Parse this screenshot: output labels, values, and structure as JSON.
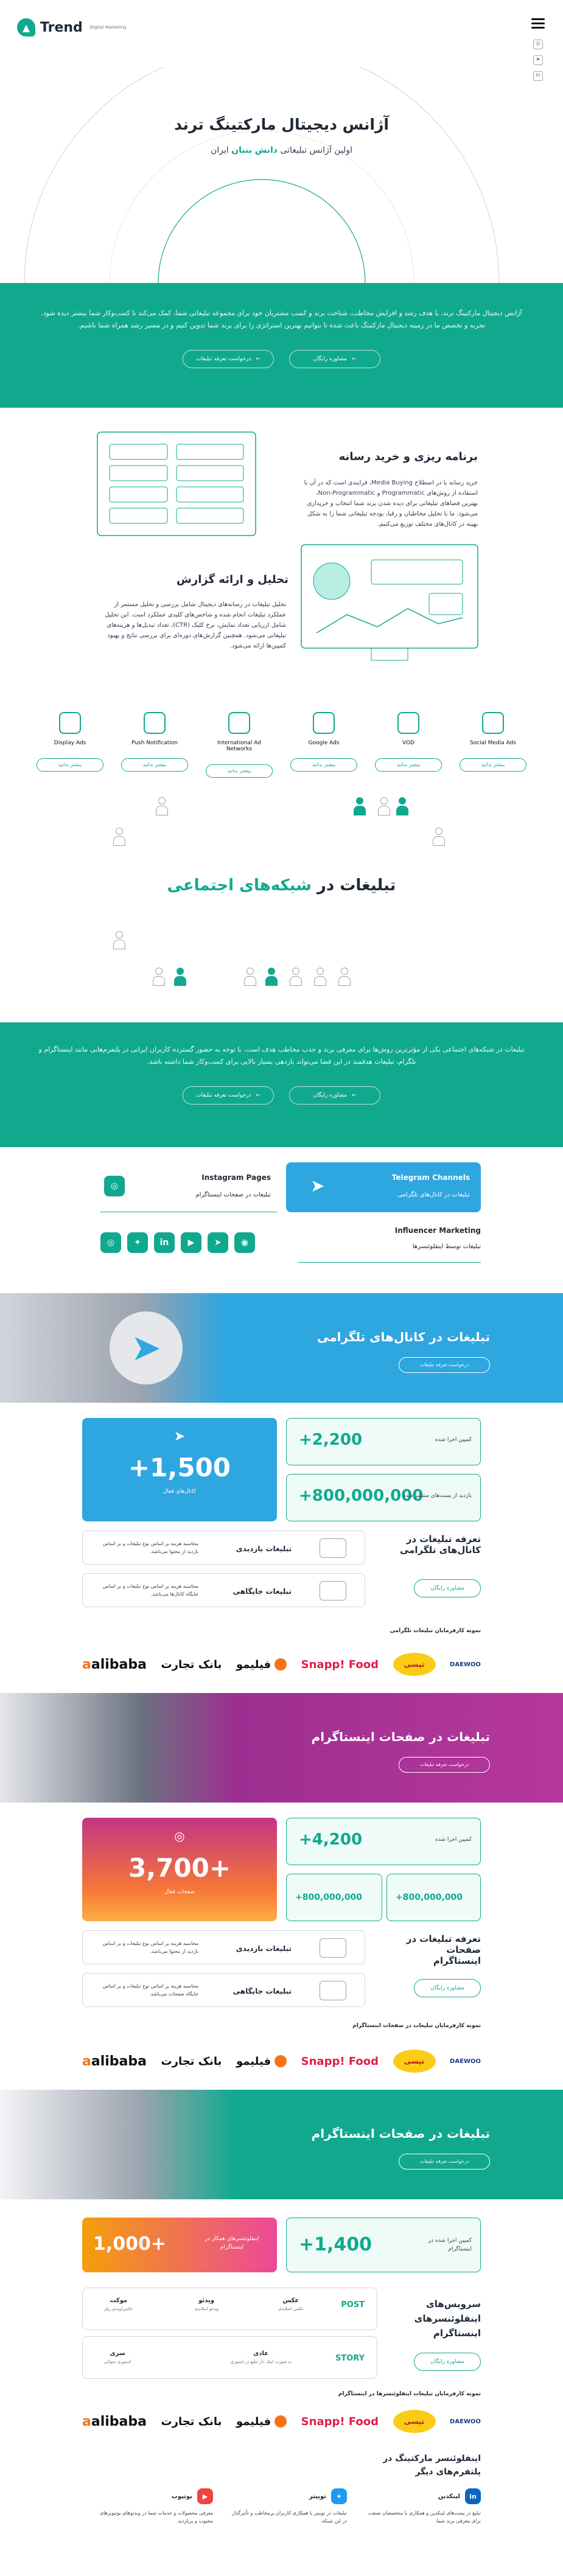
{
  "brand": {
    "name": "Trend",
    "tagline": "Digital Marketing"
  },
  "hero": {
    "title": "آژانس دیجیتال مارکتینگ ترند",
    "subtitle_pre": "اولین آژانس تبلیغاتی",
    "subtitle_highlight": "دانش بنیان",
    "subtitle_post": "ایران"
  },
  "intro": {
    "text": "آژانس دیجیتال مارکتینگ ترند، با هدف رشد و افزایش مخاطب، شناخت برند و کسب مشتریان خود برای مجموعه تبلیغاتی شما، کمک می‌کند تا کسب‌وکار شما بیشتر دیده شود. تجربه و تخصص ما در زمینه دیجیتال مارکتینگ باعث شده تا بتوانیم بهترین استراتژی را برای برند شما تدوین کنیم و در مسیر رشد همراه شما باشیم.",
    "btn_consult": "مشاوره رایگان",
    "btn_request": "درخواست تعرفه تبلیغات"
  },
  "media": {
    "title": "برنامه ریزی و خرید رسانه",
    "text": "خرید رسانه یا در اصطلاح Media Buying، فرایندی است که در آن با استفاده از روش‌های Programmatic و Non-Programmatic، بهترین فضاهای تبلیغاتی برای دیده شدن برند شما انتخاب و خریداری می‌شود. ما با تحلیل مخاطبان و رقبا، بودجه تبلیغاتی شما را به شکل بهینه در کانال‌های مختلف توزیع می‌کنیم."
  },
  "report": {
    "title": "تحلیل و ارائه گزارش",
    "text": "تحلیل تبلیغات در رسانه‌های دیجیتال شامل بررسی و تحلیل مستمر از عملکرد تبلیغات انجام شده و شاخص‌های کلیدی عملکرد است. این تحلیل شامل ارزیابی تعداد نمایش، نرخ کلیک (CTR)، تعداد تبدیل‌ها و هزینه‌های تبلیغاتی می‌شود. همچنین گزارش‌های دوره‌ای برای بررسی نتایج و بهبود کمپین‌ها ارائه می‌شود."
  },
  "services": [
    {
      "label": "Social Media Ads",
      "btn": "بیشتر بدانید"
    },
    {
      "label": "VOD",
      "btn": "بیشتر بدانید"
    },
    {
      "label": "Google Ads",
      "btn": "بیشتر بدانید"
    },
    {
      "label": "International Ad Networks",
      "btn": "بیشتر بدانید"
    },
    {
      "label": "Push Notification",
      "btn": "بیشتر بدانید"
    },
    {
      "label": "Display Ads",
      "btn": "بیشتر بدانید"
    }
  ],
  "social": {
    "title_pre": "تبلیغات در",
    "title_highlight": "شبکه‌های اجتماعی",
    "text": "تبلیغات در شبکه‌های اجتماعی یکی از مؤثرترین روش‌ها برای معرفی برند و جذب مخاطب هدف است. با توجه به حضور گسترده کاربران ایرانی در پلتفرم‌هایی مانند اینستاگرام و تلگرام، تبلیغات هدفمند در این فضا می‌تواند بازدهی بسیار بالایی برای کسب‌وکار شما داشته باشد."
  },
  "channels": {
    "telegram_en": "Telegram Channels",
    "telegram_fa": "تبلیغات در کانال‌های تلگرامی",
    "instagram_en": "Instagram Pages",
    "instagram_fa": "تبلیغات در صفحات اینستاگرام",
    "influencer_en": "Influencer Marketing",
    "influencer_fa": "تبلیغات توسط اینفلوئنسرها"
  },
  "telegram": {
    "banner_title": "تبلیغات در کانال‌های تلگرامی",
    "banner_btn": "درخواست تعرفه تبلیغات",
    "big_value": "+1,500",
    "big_label": "کانال‌های فعال",
    "stat1_value": "2,200+",
    "stat1_label": "کمپین اجرا شده",
    "stat2_value": "800,000,000+",
    "stat2_label": "بازدید از پست‌های منتشر شده",
    "tariff_title": "تعرفه تبلیغات در کانال‌های تلگرامی",
    "tariff_btn": "مشاوره رایگان",
    "ad1_title": "تبلیغات بازدیدی",
    "ad1_desc": "محاسبه هزینه بر اساس نوع تبلیغات و بر اساس بازدید از محتوا می‌باشد.",
    "ad2_title": "تبلیغات جایگاهی",
    "ad2_desc": "محاسبه هزینه بر اساس نوع تبلیغات و بر اساس جایگاه کانال‌ها می‌باشد.",
    "customers_label": "نمونه کارفرمایان تبلیغات تلگرامی"
  },
  "instagram": {
    "banner_title": "تبلیغات در صفحات اینستاگرام",
    "banner_btn": "درخواست تعرفه تبلیغات",
    "big_value": "3,700+",
    "big_label": "صفحات فعال",
    "stat1_value": "4,200+",
    "stat1_label": "کمپین اجرا شده",
    "stat2_value": "800,000,000+",
    "stat3_value": "800,000,000+",
    "tariff_title": "تعرفه تبلیغات در صفحات اینستاگرام",
    "tariff_btn": "مشاوره رایگان",
    "ad1_title": "تبلیغات بازدیدی",
    "ad1_desc": "محاسبه هزینه بر اساس نوع تبلیغات و بر اساس بازدید از محتوا می‌باشد.",
    "ad2_title": "تبلیغات جایگاهی",
    "ad2_desc": "محاسبه هزینه بر اساس نوع تبلیغات و بر اساس جایگاه صفحات می‌باشد.",
    "customers_label": "نمونه کارفرمایان تبلیغات در صفحات اینستاگرام"
  },
  "influencer": {
    "banner_title": "تبلیغات در صفحات اینستاگرام",
    "banner_btn": "درخواست تعرفه تبلیغات",
    "stat1_value": "1,400+",
    "stat1_label": "کمپین اجرا شده در اینستاگرام",
    "stat2_value": "1,000+",
    "stat2_label": "اینفلوئنسرهای همکار در اینستاگرام",
    "services_title": "سرویس‌های اینفلوئنسرهای اینستاگرام",
    "services_btn": "مشاوره رایگان",
    "post_label": "POST",
    "story_label": "STORY",
    "post_items": [
      "عکس",
      "ویدئو",
      "موکت"
    ],
    "post_subs": [
      "عکس اسلایدی",
      "ویدئو اسلایدی",
      "عکس/ویدئو ریلز"
    ],
    "story_items": [
      "عادی",
      "سری"
    ],
    "story_subs": [
      "به صورت لینک دار تبلیغ در استوری",
      "استوری متوالی"
    ],
    "customers_label": "نمونه کارفرمایان تبلیغات اینفلوئنسرها در اینستاگرام",
    "platform_title": "اینفلوئنسر مارکتینگ در پلتفرم‌های دیگر",
    "platforms": [
      "لینکدین",
      "توییتر",
      "یوتیوب"
    ],
    "platform_texts": [
      "تبلیغ در پست‌های لینکدین و همکاری با متخصصان صنعت برای معرفی برند شما.",
      "تبلیغات در توییتر با همکاری کاربران پرمخاطب و تأثیرگذار در این شبکه.",
      "معرفی محصولات و خدمات شما در ویدئوهای یوتیوبرهای محبوب و پربازدید."
    ]
  },
  "customers": [
    "alibaba",
    "بانک تجارت",
    "فیلیمو",
    "Snapp! Food",
    "تپسی",
    "DAEWOO"
  ],
  "colors": {
    "primary": "#10a98e",
    "telegram": "#2ea6e0",
    "instagram": "#c13584"
  }
}
